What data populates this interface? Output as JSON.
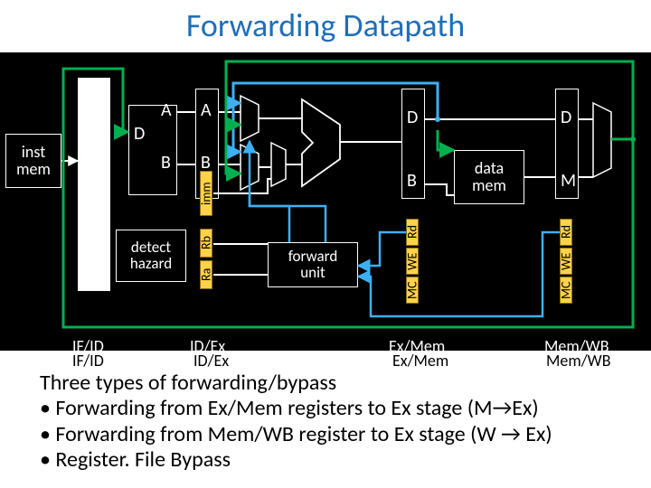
{
  "title": "Forwarding Datapath",
  "blocks": {
    "inst_mem": "inst\nmem",
    "data_mem": "data\nmem",
    "detect_hazard": "detect\nhazard",
    "forward_unit": "forward\nunit"
  },
  "ports": {
    "A1": "A",
    "A2": "A",
    "B1": "B",
    "B2": "B",
    "D1": "D",
    "D2": "D",
    "D3": "D",
    "Bex": "B",
    "M": "M",
    "imm": "imm",
    "Rb": "Rb",
    "Ra": "Ra",
    "Rd1": "Rd",
    "WE1": "WE",
    "MC1": "MC",
    "Rd2": "Rd",
    "WE2": "WE",
    "MC2": "MC"
  },
  "stages": {
    "ifid": "IF/ID",
    "idex": "ID/Ex",
    "exmem": "Ex/Mem",
    "memwb": "Mem/WB"
  },
  "explain": {
    "heading": "Three types of forwarding/bypass",
    "b1": "Forwarding from Ex/Mem registers to Ex stage (M→Ex)",
    "b2": "Forwarding from Mem/WB register to Ex stage (W → Ex)",
    "b3": "Register. File Bypass"
  }
}
